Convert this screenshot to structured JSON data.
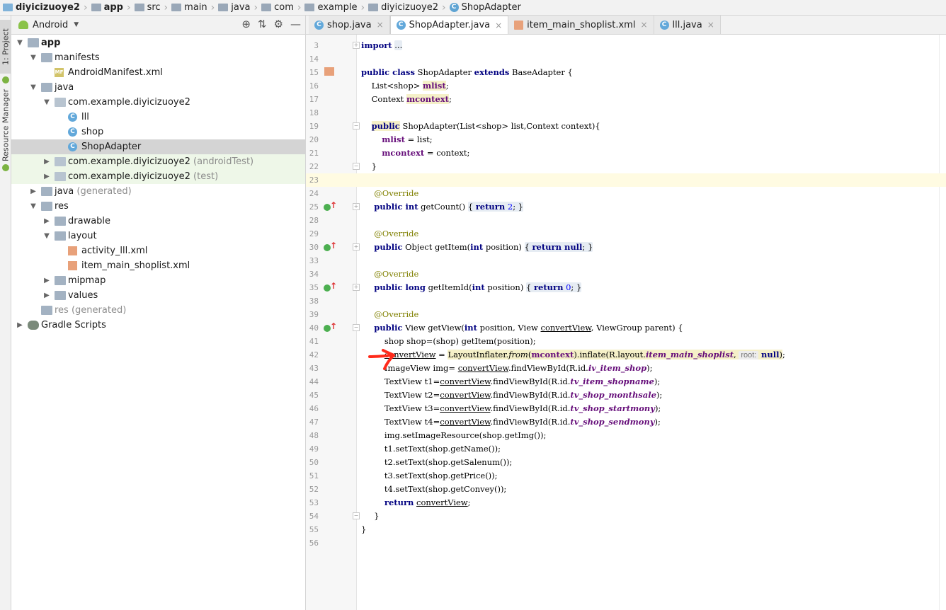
{
  "breadcrumb": {
    "items": [
      {
        "label": "diyicizuoye2",
        "bold": true,
        "icon": "module-folder-icon"
      },
      {
        "label": "app",
        "bold": true,
        "icon": "folder-icon"
      },
      {
        "label": "src",
        "bold": false,
        "icon": "folder-icon"
      },
      {
        "label": "main",
        "bold": false,
        "icon": "folder-icon"
      },
      {
        "label": "java",
        "bold": false,
        "icon": "folder-icon"
      },
      {
        "label": "com",
        "bold": false,
        "icon": "folder-icon"
      },
      {
        "label": "example",
        "bold": false,
        "icon": "folder-icon"
      },
      {
        "label": "diyicizuoye2",
        "bold": false,
        "icon": "folder-icon"
      },
      {
        "label": "ShopAdapter",
        "bold": false,
        "icon": "class-icon"
      }
    ]
  },
  "side_strip": {
    "project_label": "1: Project",
    "resource_label": "Resource Manager"
  },
  "project_panel": {
    "view_mode": "Android",
    "dropdown_glyph": "▼",
    "tools": [
      "⊕",
      "⇅",
      "⚙",
      "—"
    ],
    "tree": [
      {
        "label": "app",
        "suffix": "",
        "depth": 0,
        "expanded": true,
        "icon": "app-folder-icon",
        "bold": true
      },
      {
        "label": "manifests",
        "suffix": "",
        "depth": 1,
        "expanded": true,
        "icon": "folder-icon"
      },
      {
        "label": "AndroidManifest.xml",
        "suffix": "",
        "depth": 2,
        "icon": "manifest-file-icon"
      },
      {
        "label": "java",
        "suffix": "",
        "depth": 1,
        "expanded": true,
        "icon": "folder-icon"
      },
      {
        "label": "com.example.diyicizuoye2",
        "suffix": "",
        "depth": 2,
        "expanded": true,
        "icon": "package-icon"
      },
      {
        "label": "lll",
        "suffix": "",
        "depth": 3,
        "icon": "class-icon"
      },
      {
        "label": "shop",
        "suffix": "",
        "depth": 3,
        "icon": "class-icon"
      },
      {
        "label": "ShopAdapter",
        "suffix": "",
        "depth": 3,
        "icon": "class-icon",
        "selected": true
      },
      {
        "label": "com.example.diyicizuoye2",
        "suffix": " (androidTest)",
        "depth": 2,
        "expanded": false,
        "icon": "package-icon",
        "green": true
      },
      {
        "label": "com.example.diyicizuoye2",
        "suffix": " (test)",
        "depth": 2,
        "expanded": false,
        "icon": "package-icon",
        "green": true
      },
      {
        "label": "java",
        "suffix": " (generated)",
        "depth": 1,
        "expanded": false,
        "icon": "generated-folder-icon"
      },
      {
        "label": "res",
        "suffix": "",
        "depth": 1,
        "expanded": true,
        "icon": "res-folder-icon"
      },
      {
        "label": "drawable",
        "suffix": "",
        "depth": 2,
        "expanded": false,
        "icon": "folder-icon"
      },
      {
        "label": "layout",
        "suffix": "",
        "depth": 2,
        "expanded": true,
        "icon": "folder-icon"
      },
      {
        "label": "activity_lll.xml",
        "suffix": "",
        "depth": 3,
        "icon": "layout-xml-icon"
      },
      {
        "label": "item_main_shoplist.xml",
        "suffix": "",
        "depth": 3,
        "icon": "layout-xml-icon"
      },
      {
        "label": "mipmap",
        "suffix": "",
        "depth": 2,
        "expanded": false,
        "icon": "folder-icon"
      },
      {
        "label": "values",
        "suffix": "",
        "depth": 2,
        "expanded": false,
        "icon": "folder-icon"
      },
      {
        "label": "res",
        "suffix": " (generated)",
        "depth": 1,
        "icon": "res-folder-icon",
        "grayLabel": true
      },
      {
        "label": "Gradle Scripts",
        "suffix": "",
        "depth": 0,
        "expanded": false,
        "icon": "gradle-icon"
      }
    ]
  },
  "tabs": [
    {
      "label": "shop.java",
      "icon": "class-icon",
      "active": false
    },
    {
      "label": "ShopAdapter.java",
      "icon": "class-icon",
      "active": true
    },
    {
      "label": "item_main_shoplist.xml",
      "icon": "layout-xml-icon",
      "active": false
    },
    {
      "label": "lll.java",
      "icon": "class-icon",
      "active": false
    }
  ],
  "tab_close_glyph": "×",
  "editor": {
    "lines": [
      {
        "n": "3",
        "html": "<span class='kw'>import</span> <span class='foldbox'>...</span>",
        "fold": "+"
      },
      {
        "n": "14",
        "html": ""
      },
      {
        "n": "15",
        "html": "<span class='kw'>public class</span> ShopAdapter <span class='kw'>extends</span> BaseAdapter {",
        "gutter": "xml-link"
      },
      {
        "n": "16",
        "html": "    List&lt;shop&gt; <span class='fld hl'>mlist</span>;"
      },
      {
        "n": "17",
        "html": "    Context <span class='fld hl'>mcontext</span>;"
      },
      {
        "n": "18",
        "html": ""
      },
      {
        "n": "19",
        "html": "    <span class='kw hl'>public</span> ShopAdapter(List&lt;shop&gt; list,Context context){",
        "fold": "-"
      },
      {
        "n": "20",
        "html": "        <span class='fld'>mlist</span> = list;"
      },
      {
        "n": "21",
        "html": "        <span class='fld'>mcontext</span> = context;"
      },
      {
        "n": "22",
        "html": "    }",
        "fold": "-"
      },
      {
        "n": "23",
        "html": "",
        "current": true
      },
      {
        "n": "24",
        "html": "     <span class='ann'>@Override</span>"
      },
      {
        "n": "25",
        "html": "     <span class='kw'>public int</span> getCount() <span class='foldbox'>{ <span class='kw'>return</span> <span class='num'>2</span>; }</span>",
        "gutter": "override",
        "fold": "+"
      },
      {
        "n": "28",
        "html": ""
      },
      {
        "n": "29",
        "html": "     <span class='ann'>@Override</span>"
      },
      {
        "n": "30",
        "html": "     <span class='kw'>public</span> Object getItem(<span class='kw'>int</span> position) <span class='foldbox'>{ <span class='kw'>return null</span>; }</span>",
        "gutter": "override",
        "fold": "+"
      },
      {
        "n": "33",
        "html": ""
      },
      {
        "n": "34",
        "html": "     <span class='ann'>@Override</span>"
      },
      {
        "n": "35",
        "html": "     <span class='kw'>public long</span> getItemId(<span class='kw'>int</span> position) <span class='foldbox'>{ <span class='kw'>return</span> <span class='num'>0</span>; }</span>",
        "gutter": "override",
        "fold": "+"
      },
      {
        "n": "38",
        "html": ""
      },
      {
        "n": "39",
        "html": "     <span class='ann'>@Override</span>"
      },
      {
        "n": "40",
        "html": "     <span class='kw'>public</span> View getView(<span class='kw'>int</span> position, View <span class='ul'>convertView</span>, ViewGroup parent) {",
        "gutter": "override",
        "fold": "-"
      },
      {
        "n": "41",
        "html": "         shop shop=(shop) getItem(position);"
      },
      {
        "n": "42",
        "html": "         <span class='ul'>convertView</span> = <span class='hl'>LayoutInflater.<i>from</i>(<span class='fld'>mcontext</span>).inflate(R.layout.<span class='fldi'>item_main_shoplist</span>, <span class='hint'>root:</span> <span class='kw'>null</span>)</span>;"
      },
      {
        "n": "43",
        "html": "         ImageView img= <span class='ul'>convertView</span>.findViewById(R.id.<span class='fldi'>iv_item_shop</span>);"
      },
      {
        "n": "44",
        "html": "         TextView t1=<span class='ul'>convertView</span>.findViewById(R.id.<span class='fldi'>tv_item_shopname</span>);"
      },
      {
        "n": "45",
        "html": "         TextView t2=<span class='ul'>convertView</span>.findViewById(R.id.<span class='fldi'>tv_shop_monthsale</span>);"
      },
      {
        "n": "46",
        "html": "         TextView t3=<span class='ul'>convertView</span>.findViewById(R.id.<span class='fldi'>tv_shop_startmony</span>);"
      },
      {
        "n": "47",
        "html": "         TextView t4=<span class='ul'>convertView</span>.findViewById(R.id.<span class='fldi'>tv_shop_sendmony</span>);"
      },
      {
        "n": "48",
        "html": "         img.setImageResource(shop.getImg());"
      },
      {
        "n": "49",
        "html": "         t1.setText(shop.getName());"
      },
      {
        "n": "50",
        "html": "         t2.setText(shop.getSalenum());"
      },
      {
        "n": "51",
        "html": "         t3.setText(shop.getPrice());"
      },
      {
        "n": "52",
        "html": "         t4.setText(shop.getConvey());"
      },
      {
        "n": "53",
        "html": "         <span class='kw'>return</span> <span class='ul'>convertView</span>;"
      },
      {
        "n": "54",
        "html": "     }",
        "fold": "-"
      },
      {
        "n": "55",
        "html": "}"
      },
      {
        "n": "56",
        "html": ""
      }
    ]
  },
  "colors": {
    "keyword": "#000080",
    "field": "#660e7a",
    "annotation": "#808000",
    "number": "#0000ff",
    "selection": "#d4d4d4",
    "current_line": "#fffbe2",
    "annotation_mark": "#ff2a1a"
  }
}
